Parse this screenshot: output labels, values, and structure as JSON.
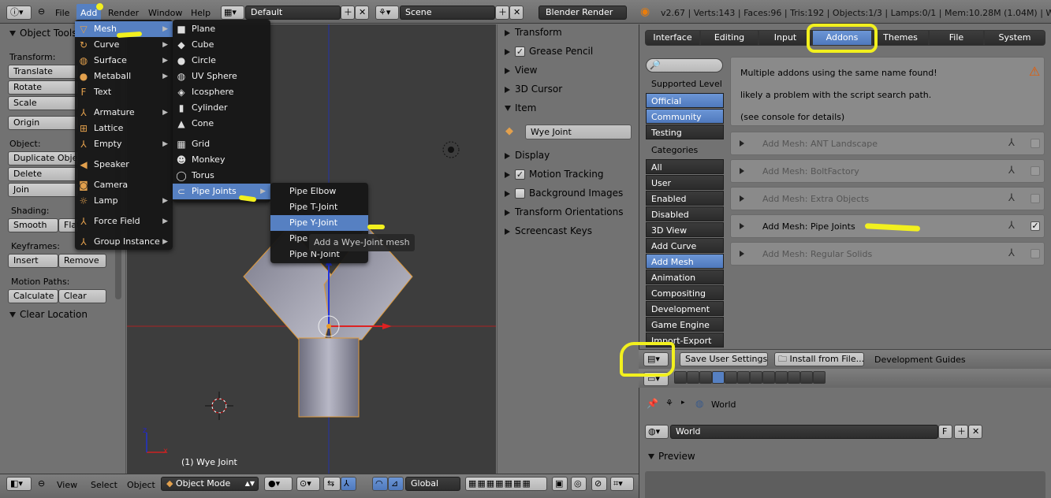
{
  "topbar": {
    "menus": [
      "File",
      "Add",
      "Render",
      "Window",
      "Help"
    ],
    "layout": "Default",
    "scene": "Scene",
    "engine": "Blender Render",
    "stats": "v2.67 | Verts:143 | Faces:96 | Tris:192 | Objects:1/3 | Lamps:0/1 | Mem:10.28M (1.04M) | Wye Joint"
  },
  "add_menu": [
    {
      "label": "Mesh",
      "icon": "mesh-icon",
      "sub": true
    },
    {
      "label": "Curve",
      "icon": "curve-icon",
      "sub": true
    },
    {
      "label": "Surface",
      "icon": "surface-icon",
      "sub": true
    },
    {
      "label": "Metaball",
      "icon": "metaball-icon",
      "sub": true
    },
    {
      "label": "Text",
      "icon": "text-icon",
      "sub": false
    },
    {
      "label": "Armature",
      "icon": "armature-icon",
      "sub": true
    },
    {
      "label": "Lattice",
      "icon": "lattice-icon",
      "sub": false
    },
    {
      "label": "Empty",
      "icon": "empty-icon",
      "sub": true
    },
    {
      "label": "Speaker",
      "icon": "speaker-icon",
      "sub": false
    },
    {
      "label": "Camera",
      "icon": "camera-icon",
      "sub": false
    },
    {
      "label": "Lamp",
      "icon": "lamp-icon",
      "sub": true
    },
    {
      "label": "Force Field",
      "icon": "force-field-icon",
      "sub": true
    },
    {
      "label": "Group Instance",
      "icon": "group-instance-icon",
      "sub": true
    }
  ],
  "mesh_menu": [
    "Plane",
    "Cube",
    "Circle",
    "UV Sphere",
    "Icosphere",
    "Cylinder",
    "Cone",
    "Grid",
    "Monkey",
    "Torus",
    "Pipe Joints"
  ],
  "pipe_menu": [
    "Pipe Elbow",
    "Pipe T-Joint",
    "Pipe Y-Joint",
    "Pipe Cross",
    "Pipe N-Joint"
  ],
  "pipe_partial": "Pipe",
  "tooltip": "Add a Wye-Joint mesh",
  "tools": {
    "title": "Object Tools",
    "transform_label": "Transform:",
    "translate": "Translate",
    "rotate": "Rotate",
    "scale": "Scale",
    "origin": "Origin",
    "object_label": "Object:",
    "duplicate": "Duplicate Objec",
    "delete": "Delete",
    "join": "Join",
    "shading_label": "Shading:",
    "smooth": "Smooth",
    "flat": "Flat",
    "keyframes_label": "Keyframes:",
    "insert": "Insert",
    "remove": "Remove",
    "motion_label": "Motion Paths:",
    "calculate": "Calculate",
    "clear": "Clear",
    "clear_location": "Clear Location"
  },
  "viewport": {
    "object_info": "(1) Wye Joint"
  },
  "properties_panel": {
    "transform": "Transform",
    "grease_pencil": "Grease Pencil",
    "view": "View",
    "cursor": "3D Cursor",
    "item": "Item",
    "item_name": "Wye Joint",
    "display": "Display",
    "motion_tracking": "Motion Tracking",
    "background_images": "Background Images",
    "transform_orientations": "Transform Orientations",
    "screencast_keys": "Screencast Keys"
  },
  "prefs": {
    "tabs": [
      "Interface",
      "Editing",
      "Input",
      "Addons",
      "Themes",
      "File",
      "System"
    ],
    "supported_level": "Supported Level",
    "levels": [
      "Official",
      "Community",
      "Testing"
    ],
    "categories_label": "Categories",
    "categories": [
      "All",
      "User",
      "Enabled",
      "Disabled",
      "3D View",
      "Add Curve",
      "Add Mesh",
      "Animation",
      "Compositing",
      "Development",
      "Game Engine",
      "Import-Export"
    ],
    "warning": [
      "Multiple addons using the same name found!",
      "likely a problem with the script search path.",
      "(see console for details)"
    ],
    "addons": [
      {
        "name": "Add Mesh: ANT Landscape",
        "enabled": false
      },
      {
        "name": "Add Mesh: BoltFactory",
        "enabled": false
      },
      {
        "name": "Add Mesh: Extra Objects",
        "enabled": false
      },
      {
        "name": "Add Mesh: Pipe Joints",
        "enabled": true
      },
      {
        "name": "Add Mesh: Regular Solids",
        "enabled": false
      }
    ],
    "save": "Save User Settings",
    "install": "Install from File...",
    "dev_guides": "Development Guides"
  },
  "world": {
    "breadcrumb": "World",
    "field": "World",
    "f": "F",
    "preview": "Preview"
  },
  "bottombar": {
    "view": "View",
    "select": "Select",
    "object": "Object",
    "mode": "Object Mode",
    "orientation": "Global"
  },
  "colors": {
    "selected": "#5680c2",
    "highlight": "#f2f01e",
    "header": "#727272"
  }
}
